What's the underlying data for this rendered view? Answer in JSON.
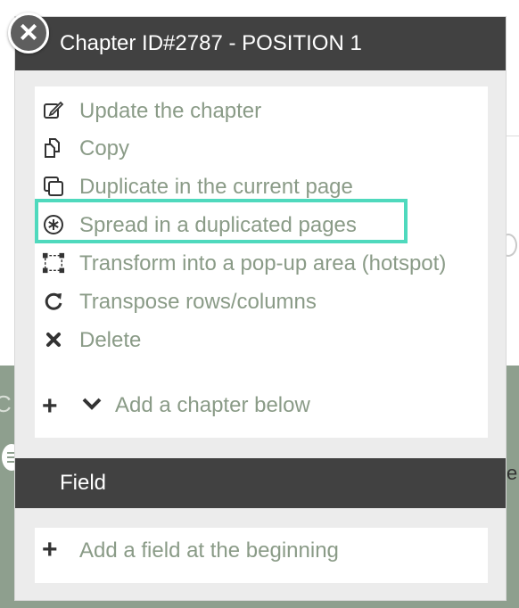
{
  "popup": {
    "title": "Chapter ID#2787 - POSITION 1",
    "close_symbol": "×",
    "menu": [
      {
        "icon": "edit-icon",
        "label": "Update the chapter"
      },
      {
        "icon": "copy-icon",
        "label": "Copy"
      },
      {
        "icon": "duplicate-icon",
        "label": "Duplicate in the current page"
      },
      {
        "icon": "spread-icon",
        "label": "Spread in a duplicated pages"
      },
      {
        "icon": "hotspot-icon",
        "label": "Transform into a pop-up area (hotspot)"
      },
      {
        "icon": "refresh-icon",
        "label": "Transpose rows/columns"
      },
      {
        "icon": "delete-icon",
        "label": "Delete"
      }
    ],
    "add_chapter_label": "Add a chapter below",
    "field_section": {
      "title": "Field",
      "add_field_label": "Add a field at the beginning"
    },
    "highlight_color": "#4fd9bd"
  },
  "background": {
    "letter_left": "C",
    "letter_right": "e"
  }
}
